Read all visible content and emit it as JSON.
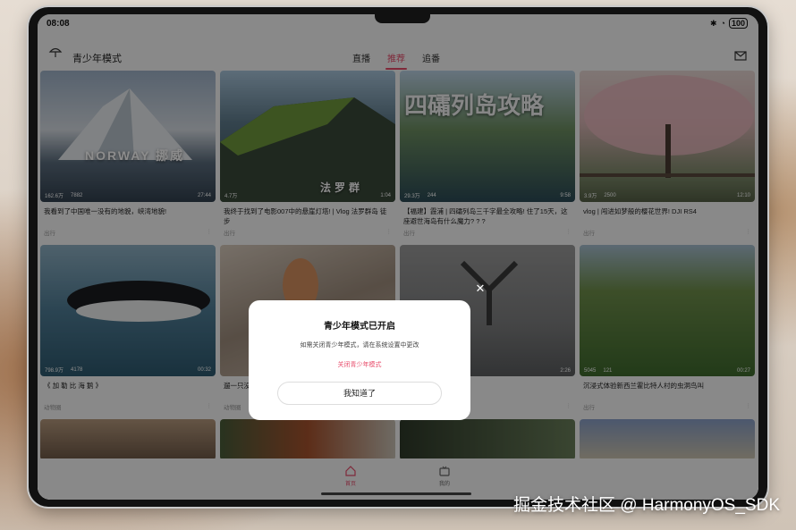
{
  "status": {
    "time": "08:08",
    "battery": "100"
  },
  "appbar": {
    "title": "青少年模式",
    "tabs": [
      {
        "label": "直播",
        "active": false
      },
      {
        "label": "推荐",
        "active": true
      },
      {
        "label": "追番",
        "active": false
      }
    ],
    "mail_badge": ""
  },
  "cards": [
    {
      "title": "我看到了中国唯一没有的地貌，峡湾地貌!",
      "category": "出行",
      "views": "162.6万",
      "danmaku": "7882",
      "duration": "27:44",
      "overlay": "NORWAY 挪威"
    },
    {
      "title": "我终于找到了电影007中的悬崖灯塔! | Vlog 法罗群岛 徒步",
      "category": "出行",
      "views": "4.7万",
      "danmaku": "",
      "duration": "1:04",
      "overlay": "法罗群"
    },
    {
      "title": "【福建】霞浦 | 四礵列岛三千字最全攻略! 住了15天，这座避世海岛有什么魔力? ? ?",
      "category": "出行",
      "views": "29.3万",
      "danmaku": "244",
      "duration": "9:58",
      "overlay": "四礵列岛攻略"
    },
    {
      "title": "vlog | 闯进如梦般的樱花世界! DJI RS4",
      "category": "出行",
      "views": "3.9万",
      "danmaku": "2500",
      "duration": "12:10",
      "overlay": ""
    },
    {
      "title": "《 加 勒 比 海 鹅 》",
      "category": "动物圈",
      "views": "798.9万",
      "danmaku": "4178",
      "duration": "00:32",
      "overlay": ""
    },
    {
      "title": "遛一只没有jiojio的猫",
      "category": "动物圈",
      "views": "",
      "danmaku": "",
      "duration": "",
      "overlay": ""
    },
    {
      "title": "",
      "category": "",
      "views": "",
      "danmaku": "",
      "duration": "2:26",
      "overlay": ""
    },
    {
      "title": "沉浸式体验新西兰霍比特人村的虫洞鸟叫",
      "category": "出行",
      "views": "5045",
      "danmaku": "121",
      "duration": "00:27",
      "overlay": ""
    }
  ],
  "bottom_nav": [
    {
      "label": "首页",
      "active": true
    },
    {
      "label": "我的",
      "active": false
    }
  ],
  "dialog": {
    "title": "青少年模式已开启",
    "description": "如需关闭青少年模式，请在系统设置中更改",
    "link": "关闭青少年模式",
    "button": "我知道了"
  },
  "watermark": "掘金技术社区 @ HarmonyOS_SDK",
  "colors": {
    "accent": "#e84c6b"
  }
}
